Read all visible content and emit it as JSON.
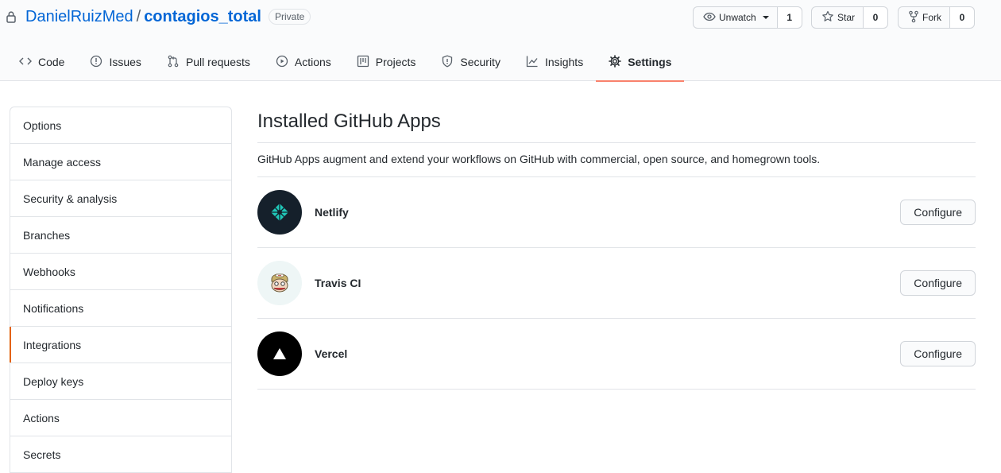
{
  "repo": {
    "owner": "DanielRuizMed",
    "separator": "/",
    "name": "contagios_total",
    "visibility": "Private"
  },
  "head_actions": {
    "watch": {
      "label": "Unwatch",
      "count": "1"
    },
    "star": {
      "label": "Star",
      "count": "0"
    },
    "fork": {
      "label": "Fork",
      "count": "0"
    }
  },
  "tabs": [
    {
      "label": "Code",
      "icon": "code-icon"
    },
    {
      "label": "Issues",
      "icon": "issue-icon"
    },
    {
      "label": "Pull requests",
      "icon": "pull-request-icon"
    },
    {
      "label": "Actions",
      "icon": "play-icon"
    },
    {
      "label": "Projects",
      "icon": "project-icon"
    },
    {
      "label": "Security",
      "icon": "shield-icon"
    },
    {
      "label": "Insights",
      "icon": "graph-icon"
    },
    {
      "label": "Settings",
      "icon": "gear-icon",
      "selected": true
    }
  ],
  "sidebar": {
    "items": [
      {
        "label": "Options"
      },
      {
        "label": "Manage access"
      },
      {
        "label": "Security & analysis"
      },
      {
        "label": "Branches"
      },
      {
        "label": "Webhooks"
      },
      {
        "label": "Notifications"
      },
      {
        "label": "Integrations",
        "selected": true
      },
      {
        "label": "Deploy keys"
      },
      {
        "label": "Actions"
      },
      {
        "label": "Secrets"
      }
    ]
  },
  "main": {
    "title": "Installed GitHub Apps",
    "description": "GitHub Apps augment and extend your workflows on GitHub with commercial, open source, and homegrown tools.",
    "apps": [
      {
        "name": "Netlify",
        "button": "Configure",
        "icon": "netlify-logo-icon"
      },
      {
        "name": "Travis CI",
        "button": "Configure",
        "icon": "travis-ci-logo-icon"
      },
      {
        "name": "Vercel",
        "button": "Configure",
        "icon": "vercel-logo-icon"
      }
    ]
  },
  "colors": {
    "link": "#0366d6",
    "selected_tab_underline": "#f9826c",
    "selected_sidebar_bar": "#e36209",
    "netlify_bg": "#15202b",
    "netlify_accent": "#20c6b7",
    "vercel_bg": "#000000"
  }
}
